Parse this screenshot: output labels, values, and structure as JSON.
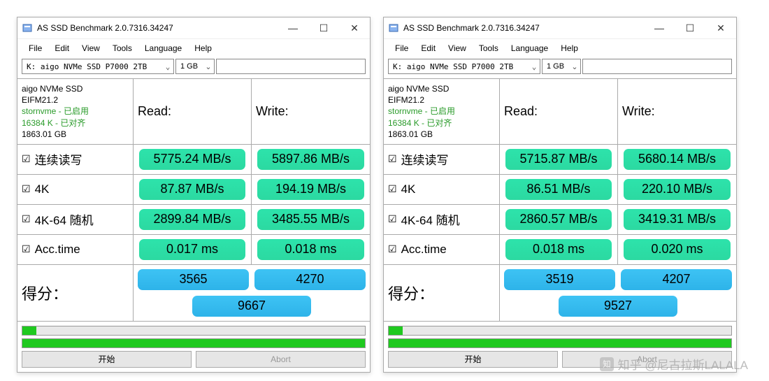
{
  "watermark": "知乎 @尼古拉斯LALALA",
  "app_title": "AS SSD Benchmark 2.0.7316.34247",
  "menu": {
    "file": "File",
    "edit": "Edit",
    "view": "View",
    "tools": "Tools",
    "language": "Language",
    "help": "Help"
  },
  "dropdown": {
    "drive": "K: aigo NVMe SSD P7000 2TB",
    "size": "1 GB"
  },
  "drive_info": {
    "name": "aigo NVMe SSD",
    "firmware": "EIFM21.2",
    "driver": "stornvme - 已启用",
    "align": "16384 K - 已对齐",
    "capacity": "1863.01 GB"
  },
  "headers": {
    "read": "Read:",
    "write": "Write:"
  },
  "rows": {
    "seq": "连续读写",
    "k4": "4K",
    "k4_64": "4K-64 随机",
    "acc": "Acc.time",
    "score": "得分："
  },
  "buttons": {
    "start": "开始",
    "abort": "Abort"
  },
  "left": {
    "seq_r": "5775.24 MB/s",
    "seq_w": "5897.86 MB/s",
    "k4_r": "87.87 MB/s",
    "k4_w": "194.19 MB/s",
    "k464_r": "2899.84 MB/s",
    "k464_w": "3485.55 MB/s",
    "acc_r": "0.017 ms",
    "acc_w": "0.018 ms",
    "score_r": "3565",
    "score_w": "4270",
    "score_t": "9667"
  },
  "right": {
    "seq_r": "5715.87 MB/s",
    "seq_w": "5680.14 MB/s",
    "k4_r": "86.51 MB/s",
    "k4_w": "220.10 MB/s",
    "k464_r": "2860.57 MB/s",
    "k464_w": "3419.31 MB/s",
    "acc_r": "0.018 ms",
    "acc_w": "0.020 ms",
    "score_r": "3519",
    "score_w": "4207",
    "score_t": "9527"
  }
}
